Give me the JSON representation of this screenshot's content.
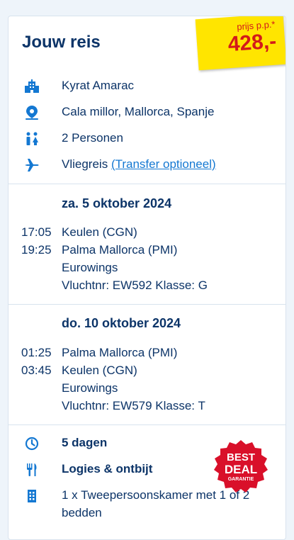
{
  "title": "Jouw reis",
  "price": {
    "label": "prijs p.p.*",
    "value": "428,-"
  },
  "info": {
    "hotel": "Kyrat Amarac",
    "location": "Cala millor, Mallorca, Spanje",
    "persons": "2 Personen",
    "travel_type": "Vliegreis",
    "transfer_link": "(Transfer optioneel)"
  },
  "flights": [
    {
      "date": "za. 5 oktober 2024",
      "dep_time": "17:05",
      "dep_airport": "Keulen (CGN)",
      "arr_time": "19:25",
      "arr_airport": "Palma Mallorca (PMI)",
      "airline": "Eurowings",
      "flight_info": "Vluchtnr: EW592 Klasse: G"
    },
    {
      "date": "do. 10 oktober 2024",
      "dep_time": "01:25",
      "dep_airport": "Palma Mallorca (PMI)",
      "arr_time": "03:45",
      "arr_airport": "Keulen (CGN)",
      "airline": "Eurowings",
      "flight_info": "Vluchtnr: EW579 Klasse: T"
    }
  ],
  "stay": {
    "duration": "5 dagen",
    "board": "Logies & ontbijt",
    "room_line1": "1 x Tweepersoonskamer met 1 of 2",
    "room_line2": "bedden"
  },
  "badge": {
    "line1": "BEST",
    "line2": "DEAL",
    "line3": "GARANTIE"
  },
  "colors": {
    "accent": "#1478d2",
    "navy": "#0c3468",
    "tag": "#ffe500",
    "price": "#d31a1a",
    "badge": "#d9102a"
  }
}
